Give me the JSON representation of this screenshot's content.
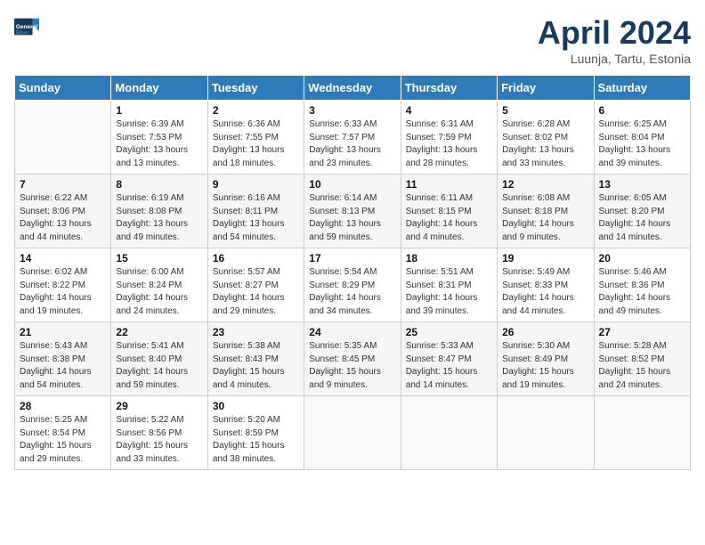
{
  "header": {
    "logo_line1": "General",
    "logo_line2": "Blue",
    "title": "April 2024",
    "subtitle": "Luunja, Tartu, Estonia"
  },
  "weekdays": [
    "Sunday",
    "Monday",
    "Tuesday",
    "Wednesday",
    "Thursday",
    "Friday",
    "Saturday"
  ],
  "weeks": [
    [
      {
        "num": "",
        "sunrise": "",
        "sunset": "",
        "daylight": ""
      },
      {
        "num": "1",
        "sunrise": "Sunrise: 6:39 AM",
        "sunset": "Sunset: 7:53 PM",
        "daylight": "Daylight: 13 hours and 13 minutes."
      },
      {
        "num": "2",
        "sunrise": "Sunrise: 6:36 AM",
        "sunset": "Sunset: 7:55 PM",
        "daylight": "Daylight: 13 hours and 18 minutes."
      },
      {
        "num": "3",
        "sunrise": "Sunrise: 6:33 AM",
        "sunset": "Sunset: 7:57 PM",
        "daylight": "Daylight: 13 hours and 23 minutes."
      },
      {
        "num": "4",
        "sunrise": "Sunrise: 6:31 AM",
        "sunset": "Sunset: 7:59 PM",
        "daylight": "Daylight: 13 hours and 28 minutes."
      },
      {
        "num": "5",
        "sunrise": "Sunrise: 6:28 AM",
        "sunset": "Sunset: 8:02 PM",
        "daylight": "Daylight: 13 hours and 33 minutes."
      },
      {
        "num": "6",
        "sunrise": "Sunrise: 6:25 AM",
        "sunset": "Sunset: 8:04 PM",
        "daylight": "Daylight: 13 hours and 39 minutes."
      }
    ],
    [
      {
        "num": "7",
        "sunrise": "Sunrise: 6:22 AM",
        "sunset": "Sunset: 8:06 PM",
        "daylight": "Daylight: 13 hours and 44 minutes."
      },
      {
        "num": "8",
        "sunrise": "Sunrise: 6:19 AM",
        "sunset": "Sunset: 8:08 PM",
        "daylight": "Daylight: 13 hours and 49 minutes."
      },
      {
        "num": "9",
        "sunrise": "Sunrise: 6:16 AM",
        "sunset": "Sunset: 8:11 PM",
        "daylight": "Daylight: 13 hours and 54 minutes."
      },
      {
        "num": "10",
        "sunrise": "Sunrise: 6:14 AM",
        "sunset": "Sunset: 8:13 PM",
        "daylight": "Daylight: 13 hours and 59 minutes."
      },
      {
        "num": "11",
        "sunrise": "Sunrise: 6:11 AM",
        "sunset": "Sunset: 8:15 PM",
        "daylight": "Daylight: 14 hours and 4 minutes."
      },
      {
        "num": "12",
        "sunrise": "Sunrise: 6:08 AM",
        "sunset": "Sunset: 8:18 PM",
        "daylight": "Daylight: 14 hours and 9 minutes."
      },
      {
        "num": "13",
        "sunrise": "Sunrise: 6:05 AM",
        "sunset": "Sunset: 8:20 PM",
        "daylight": "Daylight: 14 hours and 14 minutes."
      }
    ],
    [
      {
        "num": "14",
        "sunrise": "Sunrise: 6:02 AM",
        "sunset": "Sunset: 8:22 PM",
        "daylight": "Daylight: 14 hours and 19 minutes."
      },
      {
        "num": "15",
        "sunrise": "Sunrise: 6:00 AM",
        "sunset": "Sunset: 8:24 PM",
        "daylight": "Daylight: 14 hours and 24 minutes."
      },
      {
        "num": "16",
        "sunrise": "Sunrise: 5:57 AM",
        "sunset": "Sunset: 8:27 PM",
        "daylight": "Daylight: 14 hours and 29 minutes."
      },
      {
        "num": "17",
        "sunrise": "Sunrise: 5:54 AM",
        "sunset": "Sunset: 8:29 PM",
        "daylight": "Daylight: 14 hours and 34 minutes."
      },
      {
        "num": "18",
        "sunrise": "Sunrise: 5:51 AM",
        "sunset": "Sunset: 8:31 PM",
        "daylight": "Daylight: 14 hours and 39 minutes."
      },
      {
        "num": "19",
        "sunrise": "Sunrise: 5:49 AM",
        "sunset": "Sunset: 8:33 PM",
        "daylight": "Daylight: 14 hours and 44 minutes."
      },
      {
        "num": "20",
        "sunrise": "Sunrise: 5:46 AM",
        "sunset": "Sunset: 8:36 PM",
        "daylight": "Daylight: 14 hours and 49 minutes."
      }
    ],
    [
      {
        "num": "21",
        "sunrise": "Sunrise: 5:43 AM",
        "sunset": "Sunset: 8:38 PM",
        "daylight": "Daylight: 14 hours and 54 minutes."
      },
      {
        "num": "22",
        "sunrise": "Sunrise: 5:41 AM",
        "sunset": "Sunset: 8:40 PM",
        "daylight": "Daylight: 14 hours and 59 minutes."
      },
      {
        "num": "23",
        "sunrise": "Sunrise: 5:38 AM",
        "sunset": "Sunset: 8:43 PM",
        "daylight": "Daylight: 15 hours and 4 minutes."
      },
      {
        "num": "24",
        "sunrise": "Sunrise: 5:35 AM",
        "sunset": "Sunset: 8:45 PM",
        "daylight": "Daylight: 15 hours and 9 minutes."
      },
      {
        "num": "25",
        "sunrise": "Sunrise: 5:33 AM",
        "sunset": "Sunset: 8:47 PM",
        "daylight": "Daylight: 15 hours and 14 minutes."
      },
      {
        "num": "26",
        "sunrise": "Sunrise: 5:30 AM",
        "sunset": "Sunset: 8:49 PM",
        "daylight": "Daylight: 15 hours and 19 minutes."
      },
      {
        "num": "27",
        "sunrise": "Sunrise: 5:28 AM",
        "sunset": "Sunset: 8:52 PM",
        "daylight": "Daylight: 15 hours and 24 minutes."
      }
    ],
    [
      {
        "num": "28",
        "sunrise": "Sunrise: 5:25 AM",
        "sunset": "Sunset: 8:54 PM",
        "daylight": "Daylight: 15 hours and 29 minutes."
      },
      {
        "num": "29",
        "sunrise": "Sunrise: 5:22 AM",
        "sunset": "Sunset: 8:56 PM",
        "daylight": "Daylight: 15 hours and 33 minutes."
      },
      {
        "num": "30",
        "sunrise": "Sunrise: 5:20 AM",
        "sunset": "Sunset: 8:59 PM",
        "daylight": "Daylight: 15 hours and 38 minutes."
      },
      {
        "num": "",
        "sunrise": "",
        "sunset": "",
        "daylight": ""
      },
      {
        "num": "",
        "sunrise": "",
        "sunset": "",
        "daylight": ""
      },
      {
        "num": "",
        "sunrise": "",
        "sunset": "",
        "daylight": ""
      },
      {
        "num": "",
        "sunrise": "",
        "sunset": "",
        "daylight": ""
      }
    ]
  ]
}
